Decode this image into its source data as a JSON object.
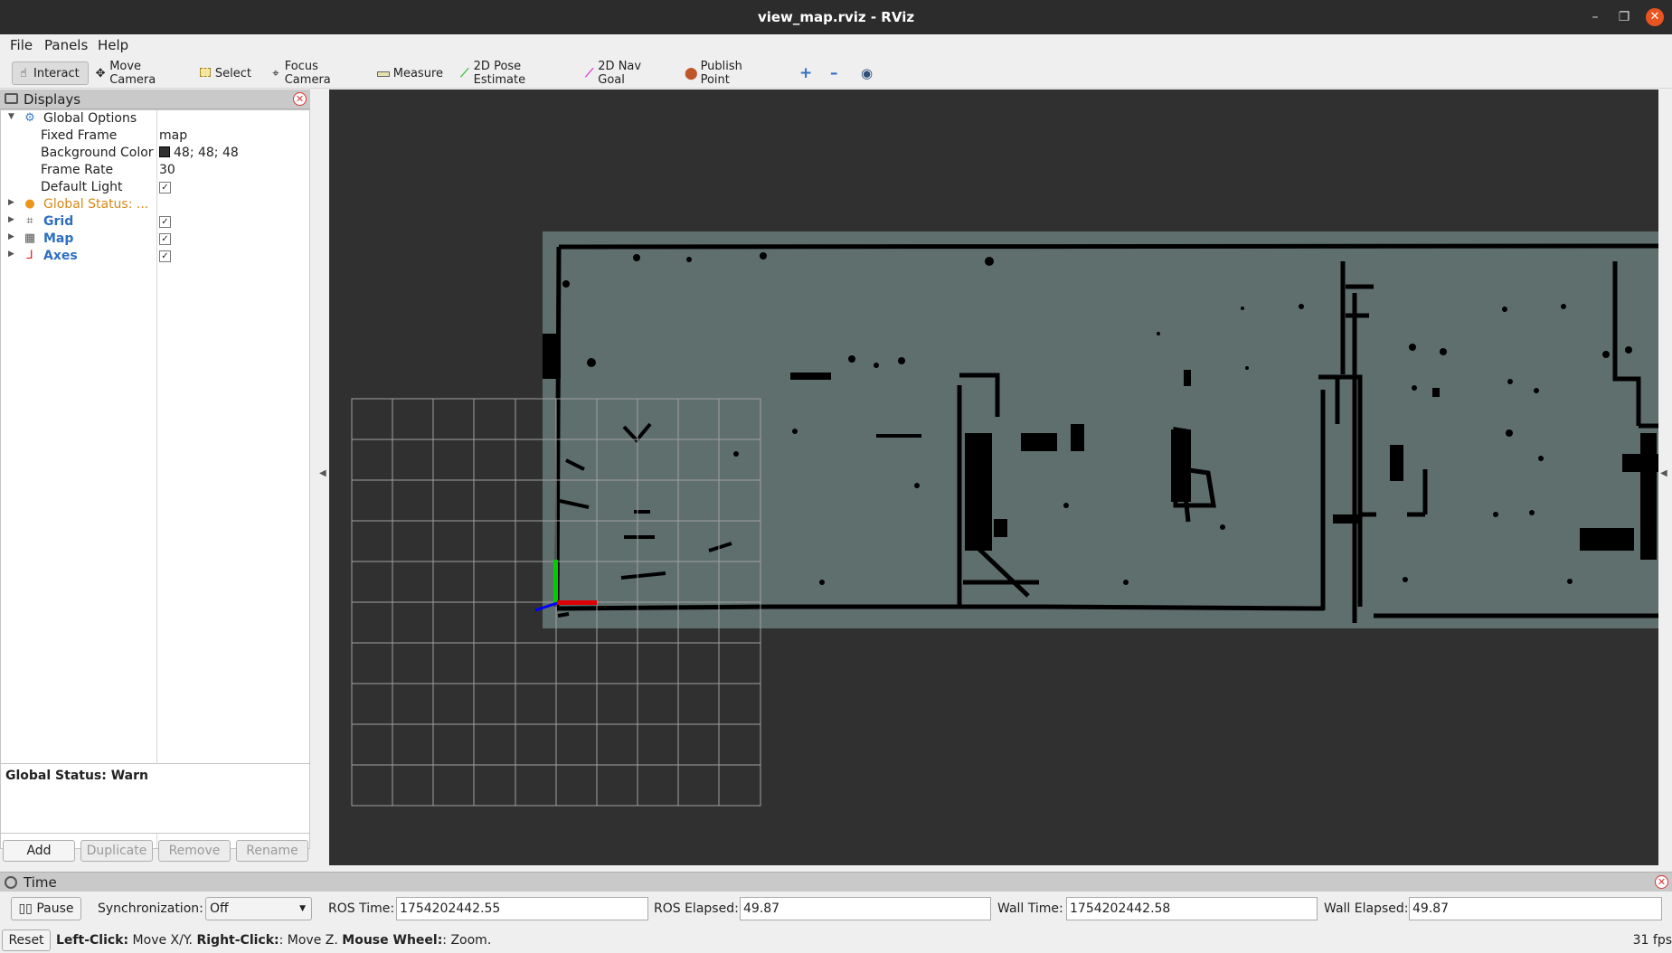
{
  "window": {
    "title": "view_map.rviz - RViz"
  },
  "menu": {
    "file": "File",
    "panels": "Panels",
    "help": "Help"
  },
  "toolbar": {
    "interact": "Interact",
    "move_camera": "Move Camera",
    "select": "Select",
    "focus_camera": "Focus Camera",
    "measure": "Measure",
    "pose_estimate": "2D Pose Estimate",
    "nav_goal": "2D Nav Goal",
    "publish_point": "Publish Point"
  },
  "displays": {
    "title": "Displays",
    "global_options": {
      "label": "Global Options",
      "fixed_frame_label": "Fixed Frame",
      "fixed_frame_value": "map",
      "background_color_label": "Background Color",
      "background_color_value": "48; 48; 48",
      "background_color_hex": "#303030",
      "frame_rate_label": "Frame Rate",
      "frame_rate_value": "30",
      "default_light_label": "Default Light",
      "default_light_checked": true
    },
    "global_status": "Global Status: ...",
    "items": [
      {
        "label": "Grid",
        "icon": "grid-icon",
        "checked": true
      },
      {
        "label": "Map",
        "icon": "map-icon",
        "checked": true
      },
      {
        "label": "Axes",
        "icon": "axes-icon",
        "checked": true
      }
    ],
    "status_box": "Global Status: Warn",
    "buttons": {
      "add": "Add",
      "duplicate": "Duplicate",
      "remove": "Remove",
      "rename": "Rename"
    }
  },
  "time": {
    "title": "Time",
    "pause_label": "Pause",
    "synchronization_label": "Synchronization:",
    "synchronization_value": "Off",
    "ros_time_label": "ROS Time:",
    "ros_time_value": "1754202442.55",
    "ros_elapsed_label": "ROS Elapsed:",
    "ros_elapsed_value": "49.87",
    "wall_time_label": "Wall Time:",
    "wall_time_value": "1754202442.58",
    "wall_elapsed_label": "Wall Elapsed:",
    "wall_elapsed_value": "49.87"
  },
  "bottom": {
    "reset_label": "Reset",
    "hint_left_click": "Left-Click:",
    "hint_left_action": " Move X/Y. ",
    "hint_right_click": "Right-Click:",
    "hint_right_action": ": Move Z. ",
    "hint_wheel": "Mouse Wheel:",
    "hint_wheel_action": ": Zoom.",
    "fps": "31 fps"
  },
  "colors": {
    "accent_close": "#e95420",
    "map_free": "#5f6f6e",
    "map_wall": "#000000",
    "axis_x": "#dd0000",
    "axis_y": "#00cc00",
    "axis_z": "#0000ff"
  }
}
